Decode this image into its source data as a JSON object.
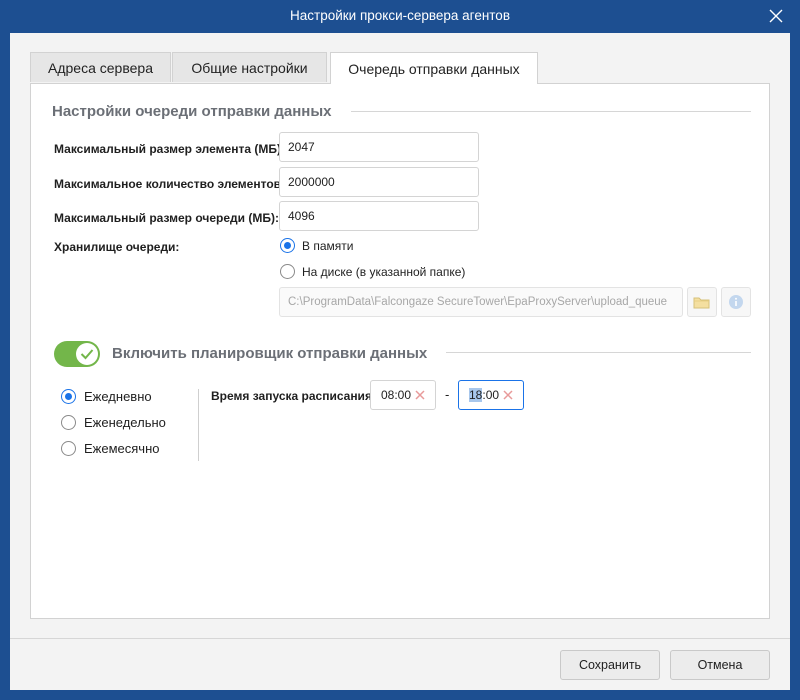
{
  "window": {
    "title": "Настройки прокси-сервера агентов"
  },
  "tabs": [
    {
      "label": "Адреса сервера",
      "active": false
    },
    {
      "label": "Общие настройки",
      "active": false
    },
    {
      "label": "Очередь отправки данных",
      "active": true
    }
  ],
  "queue": {
    "section_title": "Настройки очереди отправки данных",
    "max_item_size_label": "Максимальный размер элемента (МБ):",
    "max_item_size_value": "2047",
    "max_items_label": "Максимальное количество элементов:",
    "max_items_value": "2000000",
    "max_queue_size_label": "Максимальный размер очереди (МБ):",
    "max_queue_size_value": "4096",
    "storage_label": "Хранилище очереди:",
    "storage_options": [
      {
        "label": "В памяти",
        "checked": true
      },
      {
        "label": "На диске (в указанной папке)",
        "checked": false
      }
    ],
    "folder_path": "C:\\ProgramData\\Falcongaze SecureTower\\EpaProxyServer\\upload_queue"
  },
  "scheduler": {
    "toggle_label": "Включить планировщик отправки данных",
    "enabled": true,
    "frequency_options": [
      {
        "label": "Ежедневно",
        "checked": true
      },
      {
        "label": "Еженедельно",
        "checked": false
      },
      {
        "label": "Ежемесячно",
        "checked": false
      }
    ],
    "time_label": "Время запуска расписания:",
    "start_time": "08:00",
    "end_time_selected": "18",
    "end_time_rest": ":00",
    "separator": "-"
  },
  "footer": {
    "save_label": "Сохранить",
    "cancel_label": "Отмена"
  },
  "colors": {
    "frame": "#1d4f91",
    "accent": "#1a73e8",
    "toggle_on": "#73b64a",
    "clear_icon": "#e89a9a"
  },
  "icons": {
    "close": "close-icon",
    "folder": "folder-icon",
    "info": "info-icon",
    "check": "check-icon",
    "clear": "clear-icon"
  }
}
